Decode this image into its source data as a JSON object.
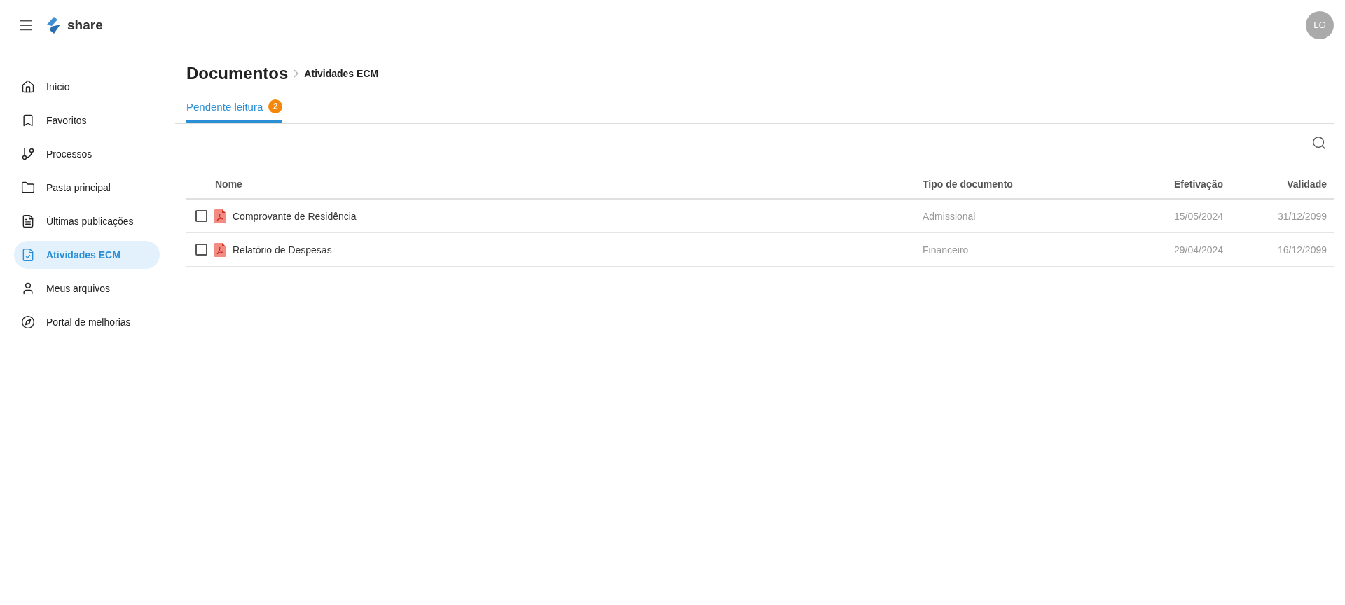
{
  "header": {
    "logo_text": "share",
    "avatar": "LG"
  },
  "sidebar": {
    "items": [
      {
        "label": "Início",
        "selected": false
      },
      {
        "label": "Favoritos",
        "selected": false
      },
      {
        "label": "Processos",
        "selected": false
      },
      {
        "label": "Pasta principal",
        "selected": false
      },
      {
        "label": "Últimas publicações",
        "selected": false
      },
      {
        "label": "Atividades ECM",
        "selected": true
      },
      {
        "label": "Meus arquivos",
        "selected": false
      },
      {
        "label": "Portal de melhorias",
        "selected": false
      }
    ]
  },
  "breadcrumb": {
    "title": "Documentos",
    "current": "Atividades ECM"
  },
  "tabs": [
    {
      "label": "Pendente leitura",
      "badge": "2",
      "selected": true
    }
  ],
  "table": {
    "columns": [
      "Nome",
      "Tipo de documento",
      "Efetivação",
      "Validade"
    ],
    "rows": [
      {
        "checked": false,
        "name": "Comprovante de Residência",
        "type": "Admissional",
        "effective": "15/05/2024",
        "valid": "31/12/2099"
      },
      {
        "checked": false,
        "name": "Relatório de Despesas",
        "type": "Financeiro",
        "effective": "29/04/2024",
        "valid": "16/12/2099"
      }
    ]
  }
}
